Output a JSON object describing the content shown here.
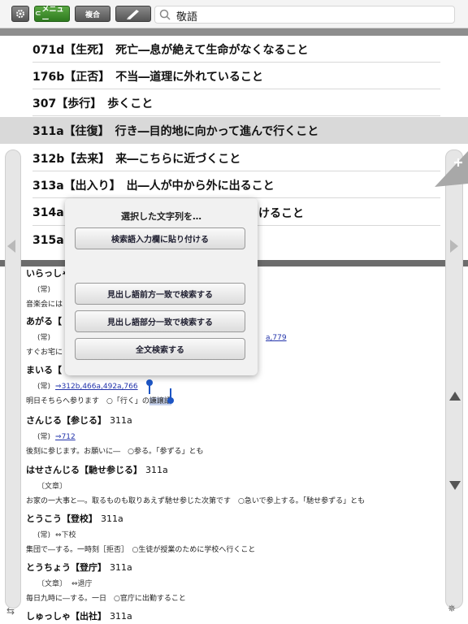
{
  "toolbar": {
    "menu_label": "メニュー",
    "fukugo_label": "複合"
  },
  "search": {
    "value": "敬語"
  },
  "entries": [
    {
      "text": "071d【生死】　死亡―息が絶えて生命がなくなること"
    },
    {
      "text": "176b【正否】　不当―道理に外れていること"
    },
    {
      "text": "307【歩行】　歩くこと"
    },
    {
      "text": "311a【往復】　行き―目的地に向かって進んで行くこと"
    },
    {
      "text": "312b【去来】　来―こちらに近づくこと"
    },
    {
      "text": "313a【出入り】　出―人が中から外に出ること"
    },
    {
      "text": "314a"
    },
    {
      "text": "315a"
    }
  ],
  "entry_314_tail": "けること",
  "popup": {
    "title": "選択した文字列を…",
    "paste_label": "検索語入力欄に貼り付ける",
    "prefix_label": "見出し語前方一致で検索する",
    "partial_label": "見出し語部分一致で検索する",
    "fulltext_label": "全文検索する"
  },
  "definitions": {
    "d1": {
      "head": "いらっしゃ",
      "meta": "(常)",
      "ex": "音楽会には"
    },
    "d2": {
      "head": "あがる【",
      "meta": "(常)",
      "link": "a,779",
      "ex": "すぐお宅に"
    },
    "d3": {
      "head": "まいる【",
      "meta": "(常)",
      "link": "⇒312b,466a,492a,766",
      "ex_a": "明日そちらへ参ります　○「行く」の",
      "ex_hl": "謙譲語"
    },
    "d4": {
      "head": "さんじる【参じる】",
      "num": "311a",
      "meta": "(常)",
      "link": "⇒712",
      "ex": "後刻に参じます。お願いに―　○参る。「参ずる」とも"
    },
    "d5": {
      "head": "はせさんじる【馳せ参じる】",
      "num": "311a",
      "meta": "〔文章〕",
      "ex": "お家の一大事と―。取るものも取りあえず馳せ参じた次第です　○急いで参上する。「馳せ参ずる」とも"
    },
    "d6": {
      "head": "とうこう【登校】",
      "num": "311a",
      "meta": "(常)",
      "rel": "⇔下校",
      "ex": "集団で―する。一時刻［拒否］　○生徒が授業のために学校へ行くこと"
    },
    "d7": {
      "head": "とうちょう【登庁】",
      "num": "311a",
      "meta": "〔文章〕",
      "rel": "⇔退庁",
      "ex": "毎日九時に―する。一日　○官庁に出勤すること"
    },
    "d8": {
      "head": "しゅっしゃ【出社】",
      "num": "311a"
    }
  }
}
